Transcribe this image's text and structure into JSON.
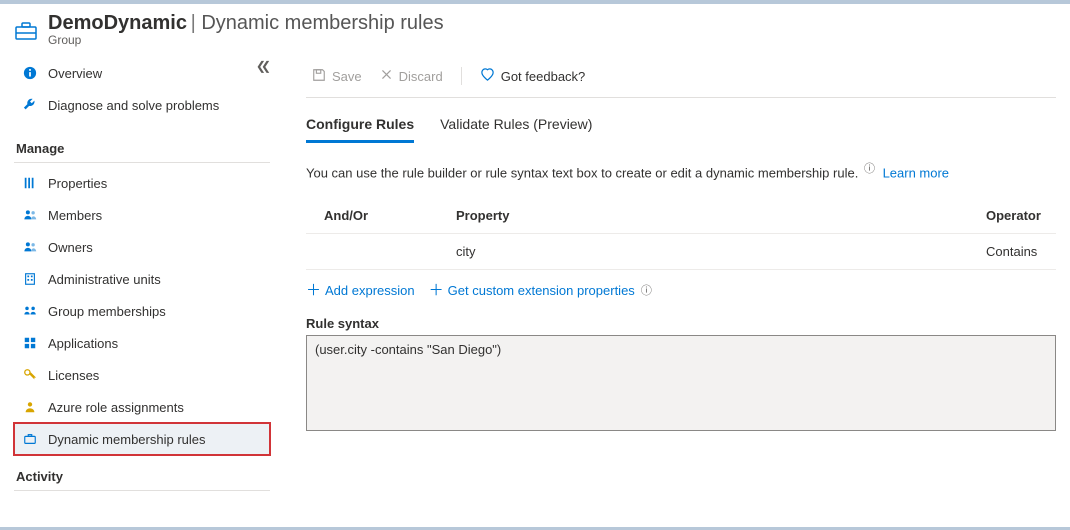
{
  "header": {
    "title": "DemoDynamic",
    "subtitle": "Dynamic membership rules",
    "resource_type": "Group"
  },
  "sidebar": {
    "items": [
      {
        "label": "Overview",
        "icon": "info"
      },
      {
        "label": "Diagnose and solve problems",
        "icon": "wrench"
      }
    ],
    "manage_label": "Manage",
    "manage_items": [
      {
        "label": "Properties",
        "icon": "props"
      },
      {
        "label": "Members",
        "icon": "people"
      },
      {
        "label": "Owners",
        "icon": "people"
      },
      {
        "label": "Administrative units",
        "icon": "building"
      },
      {
        "label": "Group memberships",
        "icon": "groups"
      },
      {
        "label": "Applications",
        "icon": "grid"
      },
      {
        "label": "Licenses",
        "icon": "key"
      },
      {
        "label": "Azure role assignments",
        "icon": "person"
      },
      {
        "label": "Dynamic membership rules",
        "icon": "briefcase",
        "selected": true
      }
    ],
    "activity_label": "Activity"
  },
  "commands": {
    "save": "Save",
    "discard": "Discard",
    "feedback": "Got feedback?"
  },
  "tabs": {
    "configure": "Configure Rules",
    "validate": "Validate Rules (Preview)"
  },
  "description": "You can use the rule builder or rule syntax text box to create or edit a dynamic membership rule.",
  "learn_more": "Learn more",
  "table": {
    "headers": {
      "andor": "And/Or",
      "property": "Property",
      "operator": "Operator"
    },
    "rows": [
      {
        "andor": "",
        "property": "city",
        "operator": "Contains"
      }
    ]
  },
  "actions": {
    "add_expression": "Add expression",
    "get_ext": "Get custom extension properties"
  },
  "rule_syntax_label": "Rule syntax",
  "rule_syntax_value": "(user.city -contains \"San Diego\")"
}
